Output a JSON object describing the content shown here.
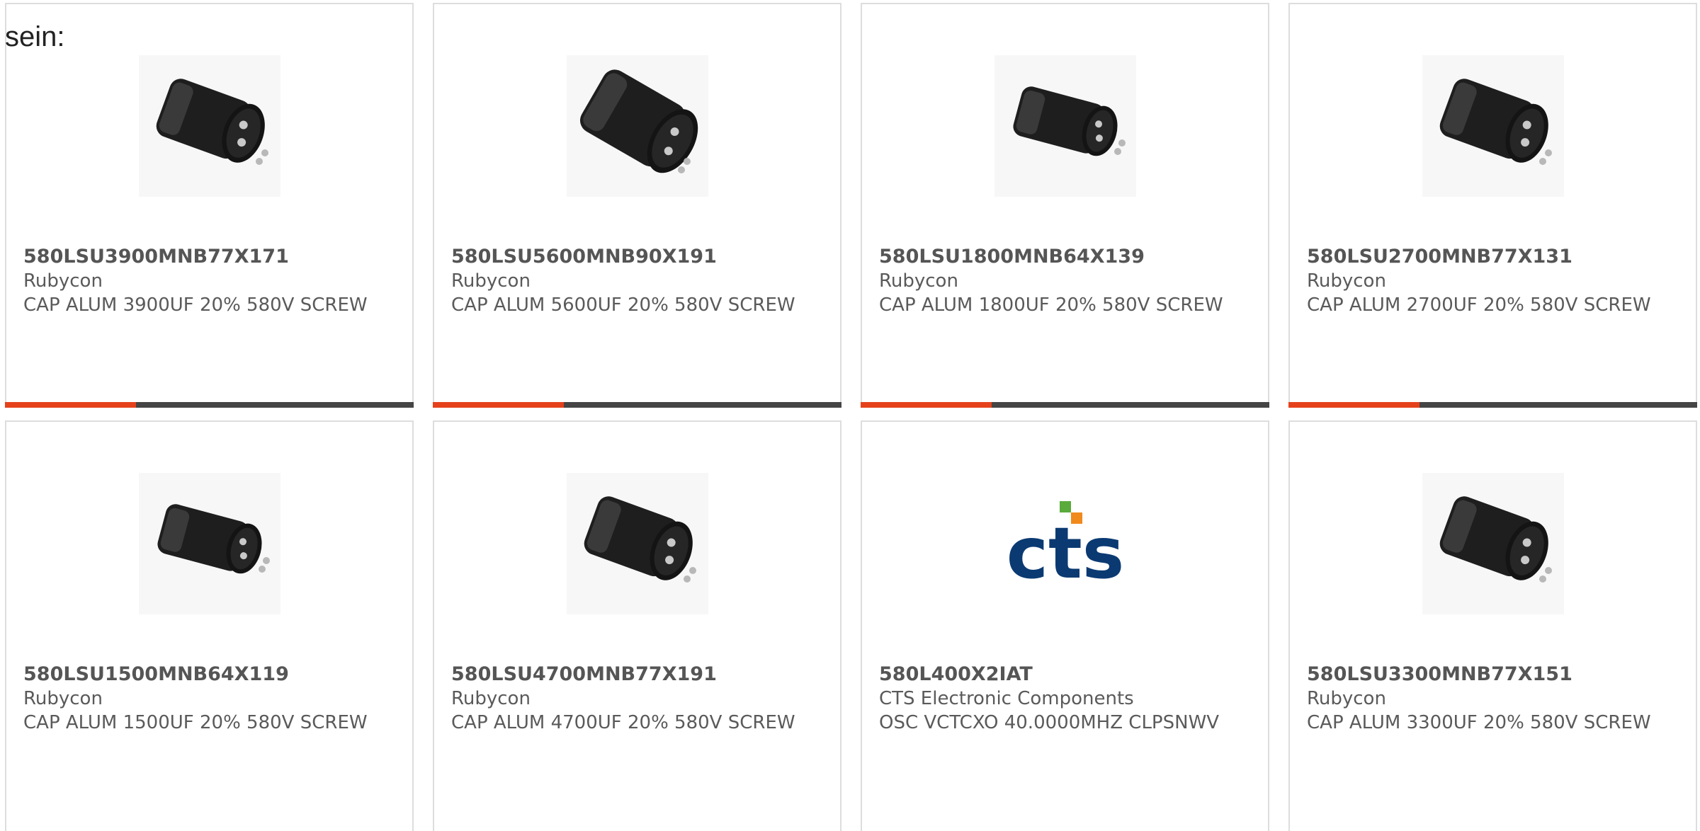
{
  "intro_text": "sein:",
  "colors": {
    "accent": "#e5421c",
    "bar": "#454545",
    "cts_blue": "#0b3a72",
    "cts_green": "#5aaa3c",
    "cts_orange": "#f08a1c"
  },
  "products": [
    {
      "part_number": "580LSU3900MNB77X171",
      "manufacturer": "Rubycon",
      "description": "CAP ALUM 3900UF 20% 580V SCREW",
      "image": "capacitor-image",
      "progress": 0.32
    },
    {
      "part_number": "580LSU5600MNB90X191",
      "manufacturer": "Rubycon",
      "description": "CAP ALUM 5600UF 20% 580V SCREW",
      "image": "capacitor-image",
      "progress": 0.32
    },
    {
      "part_number": "580LSU1800MNB64X139",
      "manufacturer": "Rubycon",
      "description": "CAP ALUM 1800UF 20% 580V SCREW",
      "image": "capacitor-image",
      "progress": 0.32
    },
    {
      "part_number": "580LSU2700MNB77X131",
      "manufacturer": "Rubycon",
      "description": "CAP ALUM 2700UF 20% 580V SCREW",
      "image": "capacitor-image",
      "progress": 0.32
    },
    {
      "part_number": "580LSU1500MNB64X119",
      "manufacturer": "Rubycon",
      "description": "CAP ALUM 1500UF 20% 580V SCREW",
      "image": "capacitor-image"
    },
    {
      "part_number": "580LSU4700MNB77X191",
      "manufacturer": "Rubycon",
      "description": "CAP ALUM 4700UF 20% 580V SCREW",
      "image": "capacitor-image"
    },
    {
      "part_number": "580L400X2IAT",
      "manufacturer": "CTS Electronic Components",
      "description": "OSC VCTCXO 40.0000MHZ CLPSNWV",
      "image": "cts-logo",
      "logo_text": "cts"
    },
    {
      "part_number": "580LSU3300MNB77X151",
      "manufacturer": "Rubycon",
      "description": "CAP ALUM 3300UF 20% 580V SCREW",
      "image": "capacitor-image"
    }
  ]
}
